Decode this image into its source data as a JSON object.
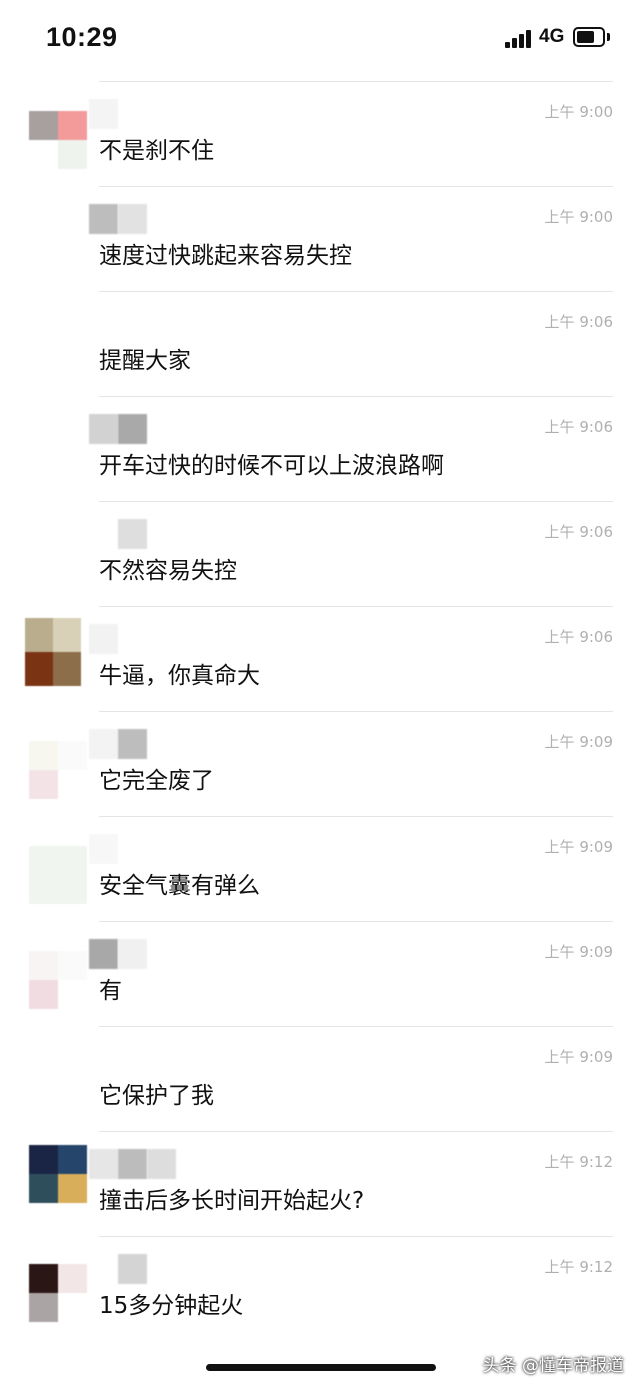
{
  "status_bar": {
    "time": "10:29",
    "network": "4G"
  },
  "messages": [
    {
      "time": "上午 9:00",
      "text": "不是刹不住"
    },
    {
      "time": "上午 9:00",
      "text": "速度过快跳起来容易失控"
    },
    {
      "time": "上午 9:06",
      "text": "提醒大家"
    },
    {
      "time": "上午 9:06",
      "text": "开车过快的时候不可以上波浪路啊"
    },
    {
      "time": "上午 9:06",
      "text": "不然容易失控"
    },
    {
      "time": "上午 9:06",
      "text": "牛逼，你真命大"
    },
    {
      "time": "上午 9:09",
      "text": "它完全废了"
    },
    {
      "time": "上午 9:09",
      "text": "安全气囊有弹么"
    },
    {
      "time": "上午 9:09",
      "text": "有"
    },
    {
      "time": "上午 9:09",
      "text": "它保护了我"
    },
    {
      "time": "上午 9:12",
      "text": "撞击后多长时间开始起火?"
    },
    {
      "time": "上午 9:12",
      "text": "15多分钟起火"
    }
  ],
  "watermark": "头条 @懂车帝报道",
  "colors": {
    "divider": "#e4e4e4",
    "timestamp": "#b0b0b0",
    "text": "#111111"
  }
}
